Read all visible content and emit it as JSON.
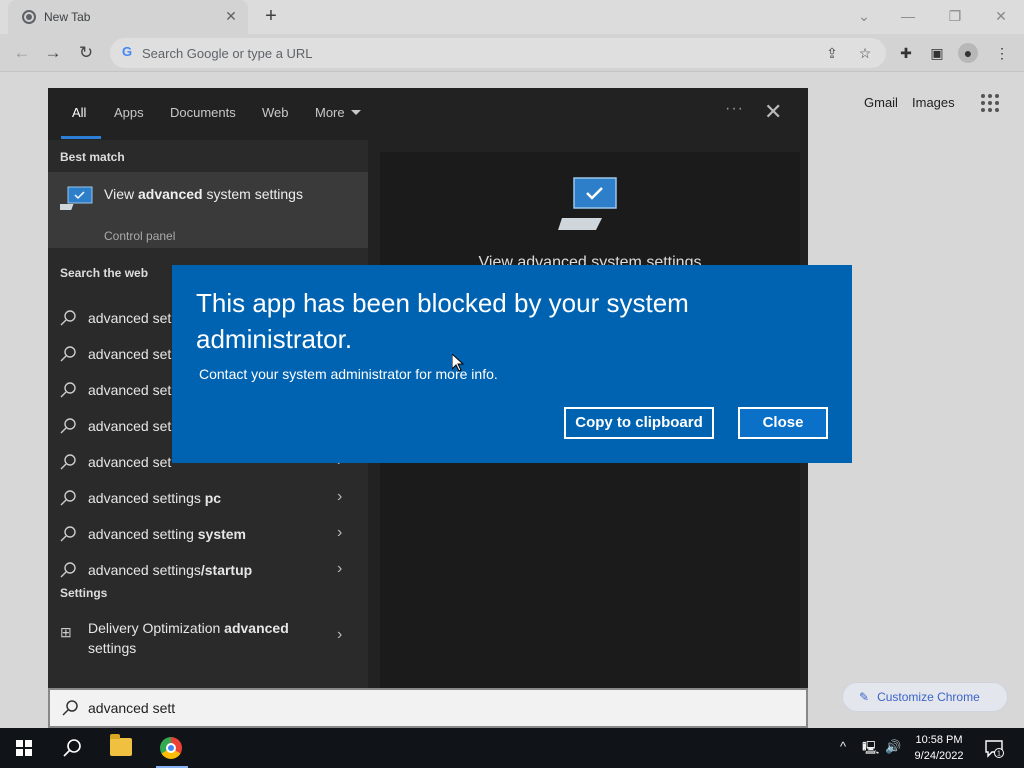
{
  "browser": {
    "tab_title": "New Tab",
    "tab_close": "✕",
    "new_tab": "+",
    "omnibox_placeholder": "Search Google or type a URL",
    "window_controls": {
      "chevron": "⌄",
      "minimize": "—",
      "restore": "❐",
      "close": "✕"
    }
  },
  "ntp": {
    "gmail": "Gmail",
    "images": "Images",
    "customize": "Customize Chrome"
  },
  "search_panel": {
    "tabs": [
      "All",
      "Apps",
      "Documents",
      "Web",
      "More"
    ],
    "best_match_heading": "Best match",
    "best_match": {
      "title_pre": "View ",
      "title_bold": "advanced",
      "title_post": " system settings",
      "subtitle": "Control panel"
    },
    "web_heading": "Search the web",
    "web_results": [
      {
        "prefix": "advanced set",
        "suffix": ""
      },
      {
        "prefix": "advanced set",
        "suffix": ""
      },
      {
        "prefix": "advanced set",
        "suffix": ""
      },
      {
        "prefix": "advanced set",
        "suffix": ""
      },
      {
        "prefix": "advanced set",
        "suffix": ""
      },
      {
        "prefix": "advanced settings",
        "suffix": " pc"
      },
      {
        "prefix": "advanced setting",
        "suffix": " system"
      },
      {
        "prefix": "advanced settings",
        "suffix": "/startup"
      }
    ],
    "settings_heading": "Settings",
    "settings_item": {
      "pre": "Delivery Optimization ",
      "bold": "advanced",
      "post": " settings"
    },
    "preview_title": "View advanced system settings",
    "query": "advanced sett"
  },
  "dialog": {
    "title": "This app has been blocked by your system administrator.",
    "message": "Contact your system administrator for more info.",
    "copy_button": "Copy to clipboard",
    "close_button": "Close"
  },
  "taskbar": {
    "time": "10:58 PM",
    "date": "9/24/2022",
    "notification_count": "1"
  }
}
